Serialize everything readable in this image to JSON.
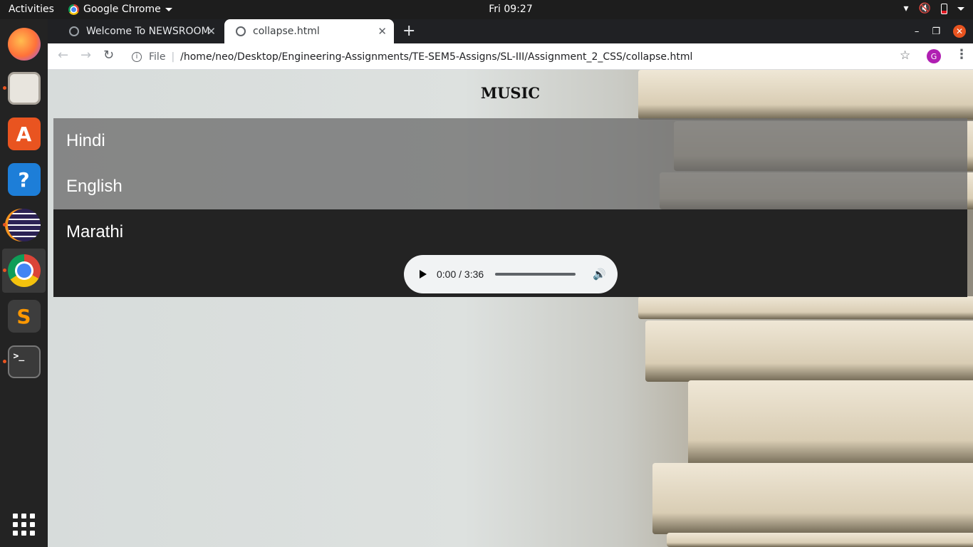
{
  "topbar": {
    "activities": "Activities",
    "app_name": "Google Chrome",
    "clock": "Fri 09:27"
  },
  "dock": {
    "apps": [
      "firefox-icon",
      "files-icon",
      "software-center-icon",
      "help-icon",
      "eclipse-icon",
      "chrome-icon",
      "sublime-text-icon",
      "terminal-icon"
    ],
    "terminal_glyph": ">_",
    "help_glyph": "?"
  },
  "browser": {
    "tabs": [
      {
        "title": "Welcome To NEWSROOM",
        "active": false
      },
      {
        "title": "collapse.html",
        "active": true
      }
    ],
    "new_tab": "+",
    "omnibox": {
      "scheme_label": "File",
      "url": "/home/neo/Desktop/Engineering-Assignments/TE-SEM5-Assigns/SL-III/Assignment_2_CSS/collapse.html"
    },
    "profile_initial": "G"
  },
  "page": {
    "title": "MUSIC",
    "sections": [
      {
        "label": "Hindi",
        "expanded": false
      },
      {
        "label": "English",
        "expanded": false
      },
      {
        "label": "Marathi",
        "expanded": true
      }
    ],
    "audio": {
      "time": "0:00 / 3:36",
      "progress": 0
    }
  },
  "colors": {
    "accent_orange": "#e95420",
    "collapsed_bg": "#6e6e6e",
    "expanded_bg": "#232323"
  }
}
